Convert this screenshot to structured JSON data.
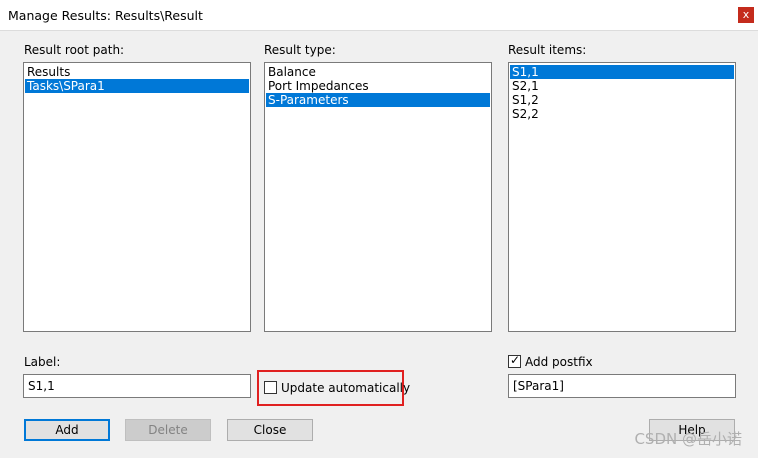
{
  "window": {
    "title": "Manage Results: Results\\Result",
    "close_glyph": "x"
  },
  "root_path": {
    "label": "Result root path:",
    "items": [
      "Results",
      "Tasks\\SPara1"
    ],
    "selected_index": 1
  },
  "result_type": {
    "label": "Result type:",
    "items": [
      "Balance",
      "Port Impedances",
      "S-Parameters"
    ],
    "selected_index": 2
  },
  "result_items": {
    "label": "Result items:",
    "items": [
      "S1,1",
      "S2,1",
      "S1,2",
      "S2,2"
    ],
    "selected_index": 0
  },
  "label_field": {
    "label": "Label:",
    "value": "S1,1"
  },
  "update_automatically": {
    "label": "Update automatically",
    "checked": false,
    "highlight_color": "#e02020"
  },
  "add_postfix": {
    "label": "Add postfix",
    "checked": true,
    "value": "[SPara1]"
  },
  "buttons": {
    "add": "Add",
    "delete": "Delete",
    "close": "Close",
    "help": "Help"
  },
  "watermark": "CSDN @岳小诺",
  "colors": {
    "selection": "#0078d7",
    "titlebar_close": "#c42b1c"
  }
}
